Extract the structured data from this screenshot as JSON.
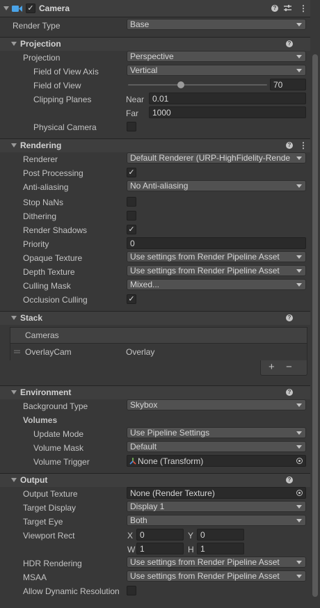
{
  "component": {
    "title": "Camera"
  },
  "render_type": {
    "label": "Render Type",
    "value": "Base"
  },
  "projection": {
    "section": "Projection",
    "projection_label": "Projection",
    "projection_value": "Perspective",
    "fov_axis_label": "Field of View Axis",
    "fov_axis_value": "Vertical",
    "fov_label": "Field of View",
    "fov_value": "70",
    "fov_fraction": 0.38,
    "clipping_label": "Clipping Planes",
    "near_label": "Near",
    "near_value": "0.01",
    "far_label": "Far",
    "far_value": "1000",
    "physical_label": "Physical Camera"
  },
  "rendering": {
    "section": "Rendering",
    "renderer_label": "Renderer",
    "renderer_value": "Default Renderer (URP-HighFidelity-Rende",
    "post_label": "Post Processing",
    "aa_label": "Anti-aliasing",
    "aa_value": "No Anti-aliasing",
    "nan_label": "Stop NaNs",
    "dither_label": "Dithering",
    "shadows_label": "Render Shadows",
    "priority_label": "Priority",
    "priority_value": "0",
    "opaque_label": "Opaque Texture",
    "opaque_value": "Use settings from Render Pipeline Asset",
    "depth_label": "Depth Texture",
    "depth_value": "Use settings from Render Pipeline Asset",
    "culling_label": "Culling Mask",
    "culling_value": "Mixed...",
    "occlusion_label": "Occlusion Culling"
  },
  "stack": {
    "section": "Stack",
    "list_header": "Cameras",
    "item_name": "OverlayCam",
    "item_type": "Overlay",
    "add_label": "+",
    "remove_label": "−"
  },
  "environment": {
    "section": "Environment",
    "bg_label": "Background Type",
    "bg_value": "Skybox",
    "volumes_label": "Volumes",
    "update_label": "Update Mode",
    "update_value": "Use Pipeline Settings",
    "mask_label": "Volume Mask",
    "mask_value": "Default",
    "trigger_label": "Volume Trigger",
    "trigger_value": "None (Transform)"
  },
  "output": {
    "section": "Output",
    "tex_label": "Output Texture",
    "tex_value": "None (Render Texture)",
    "display_label": "Target Display",
    "display_value": "Display 1",
    "eye_label": "Target Eye",
    "eye_value": "Both",
    "viewport_label": "Viewport Rect",
    "x_label": "X",
    "x_value": "0",
    "y_label": "Y",
    "y_value": "0",
    "w_label": "W",
    "w_value": "1",
    "h_label": "H",
    "h_value": "1",
    "hdr_label": "HDR Rendering",
    "hdr_value": "Use settings from Render Pipeline Asset",
    "msaa_label": "MSAA",
    "msaa_value": "Use settings from Render Pipeline Asset",
    "dynres_label": "Allow Dynamic Resolution"
  }
}
